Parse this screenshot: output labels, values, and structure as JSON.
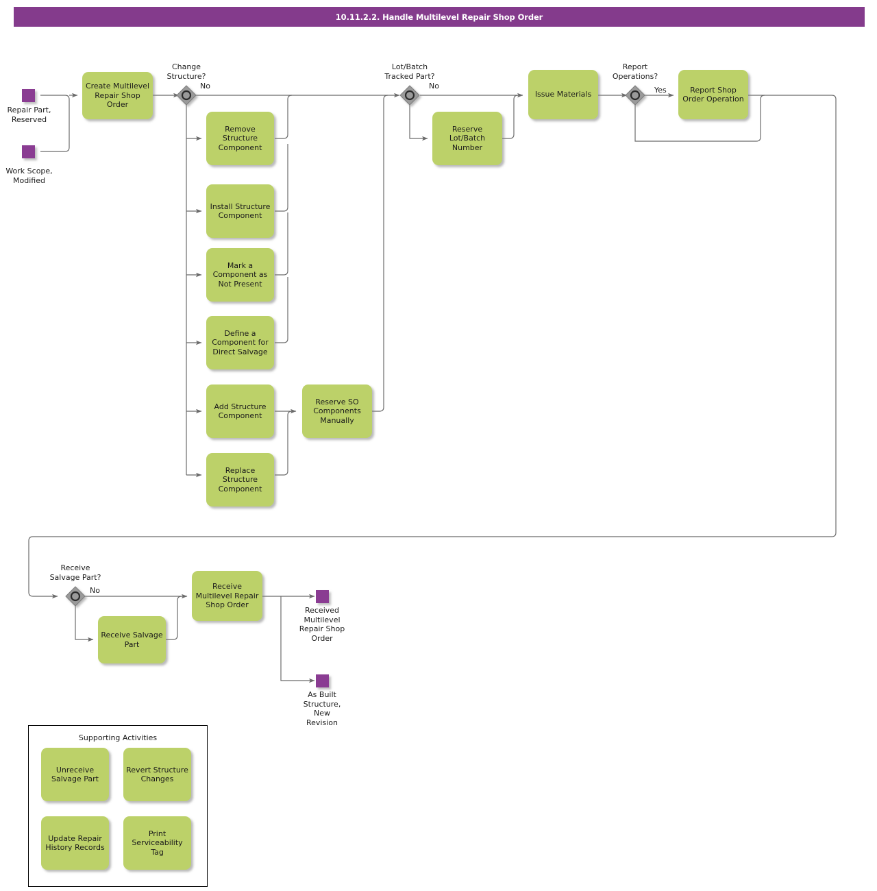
{
  "header": {
    "title": "10.11.2.2. Handle Multilevel Repair Shop Order"
  },
  "diagram": {
    "type": "bpmn-flowchart",
    "colors": {
      "header_purple": "#843B8C",
      "task_green": "#BCD169",
      "event_purple": "#8A3C92",
      "gateway_gray": "#9A9A9A",
      "line_gray": "#6B6B6B"
    },
    "start_events": [
      {
        "id": "ev-repair-part-reserved",
        "label": "Repair Part,\nReserved"
      },
      {
        "id": "ev-work-scope-modified",
        "label": "Work Scope,\nModified"
      }
    ],
    "end_events": [
      {
        "id": "ev-received-mrso",
        "label": "Received\nMultilevel\nRepair Shop\nOrder"
      },
      {
        "id": "ev-as-built-structure",
        "label": "As Built\nStructure,\nNew\nRevision"
      }
    ],
    "gateways": [
      {
        "id": "gw-change-structure",
        "label": "Change\nStructure?",
        "branch_label": "No"
      },
      {
        "id": "gw-lot-batch",
        "label": "Lot/Batch\nTracked Part?",
        "branch_label": "No"
      },
      {
        "id": "gw-report-operations",
        "label": "Report\nOperations?",
        "branch_label": "Yes"
      },
      {
        "id": "gw-receive-salvage",
        "label": "Receive\nSalvage Part?",
        "branch_label": "No"
      }
    ],
    "tasks": [
      {
        "id": "task-create-mrso",
        "label": "Create Multilevel\nRepair Shop\nOrder"
      },
      {
        "id": "task-remove-structure-component",
        "label": "Remove\nStructure\nComponent"
      },
      {
        "id": "task-install-structure-component",
        "label": "Install Structure\nComponent"
      },
      {
        "id": "task-mark-component-not-present",
        "label": "Mark a\nComponent as\nNot Present"
      },
      {
        "id": "task-define-component-direct-salvage",
        "label": "Define a\nComponent  for\nDirect Salvage"
      },
      {
        "id": "task-add-structure-component",
        "label": "Add Structure\nComponent"
      },
      {
        "id": "task-replace-structure-component",
        "label": "Replace\nStructure\nComponent"
      },
      {
        "id": "task-reserve-so-components-manually",
        "label": "Reserve SO\nComponents\nManually"
      },
      {
        "id": "task-reserve-lot-batch-number",
        "label": "Reserve\nLot/Batch\nNumber"
      },
      {
        "id": "task-issue-materials",
        "label": "Issue Materials"
      },
      {
        "id": "task-report-shop-order-operation",
        "label": "Report Shop\nOrder Operation"
      },
      {
        "id": "task-receive-salvage-part",
        "label": "Receive Salvage\nPart"
      },
      {
        "id": "task-receive-mrso",
        "label": "Receive\nMultilevel Repair\nShop Order"
      }
    ],
    "supporting_group": {
      "title": "Supporting Activities",
      "tasks": [
        {
          "id": "task-unreceive-salvage-part",
          "label": "Unreceive\nSalvage Part"
        },
        {
          "id": "task-revert-structure-changes",
          "label": "Revert Structure\nChanges"
        },
        {
          "id": "task-update-repair-history-records",
          "label": "Update Repair\nHistory Records"
        },
        {
          "id": "task-print-serviceability-tag",
          "label": "Print\nServiceability\nTag"
        }
      ]
    }
  }
}
